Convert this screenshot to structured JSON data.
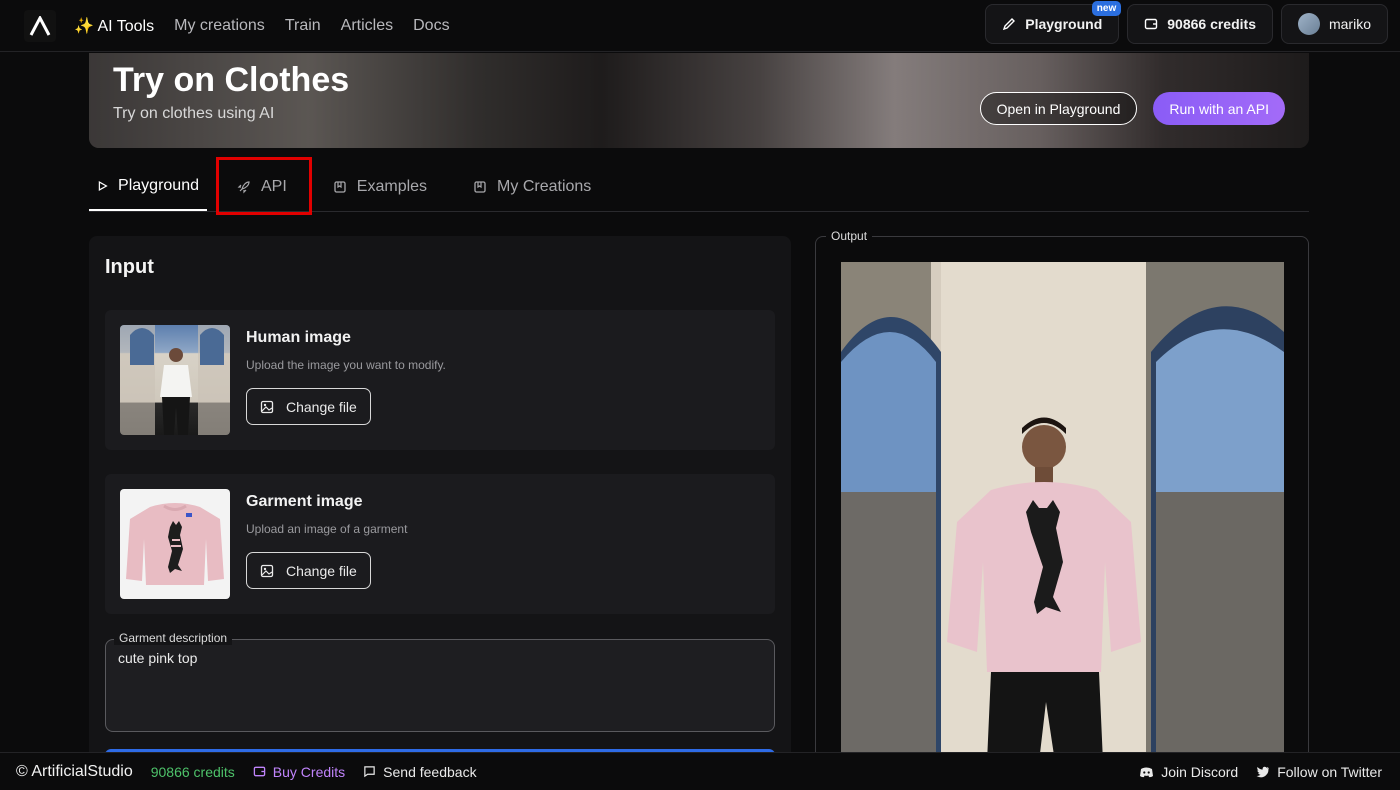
{
  "nav": {
    "brand": "✨ AI Tools",
    "items": [
      "My creations",
      "Train",
      "Articles",
      "Docs"
    ]
  },
  "top_right": {
    "playground": "Playground",
    "new_badge": "new",
    "credits": "90866 credits",
    "user": "mariko"
  },
  "hero": {
    "title": "Try on Clothes",
    "subtitle": "Try on clothes using AI",
    "open_playground": "Open in Playground",
    "run_api": "Run with an API"
  },
  "tabs": [
    {
      "label": "Playground",
      "icon": "play-icon"
    },
    {
      "label": "API",
      "icon": "rocket-icon"
    },
    {
      "label": "Examples",
      "icon": "bookmark-icon"
    },
    {
      "label": "My Creations",
      "icon": "bookmark-icon"
    }
  ],
  "input": {
    "title": "Input",
    "human": {
      "title": "Human image",
      "desc": "Upload the image you want to modify.",
      "button": "Change file"
    },
    "garment": {
      "title": "Garment image",
      "desc": "Upload an image of a garment",
      "button": "Change file"
    },
    "description": {
      "label": "Garment description",
      "value": "cute pink top"
    }
  },
  "output": {
    "label": "Output"
  },
  "footer": {
    "brand": "© ArtificialStudio",
    "credits": "90866 credits",
    "buy": "Buy Credits",
    "feedback": "Send feedback",
    "discord": "Join Discord",
    "twitter": "Follow on Twitter"
  },
  "colors": {
    "accent_purple": "#8a5cf6",
    "credits_green": "#4ec26a",
    "highlight_red": "#e10000"
  }
}
